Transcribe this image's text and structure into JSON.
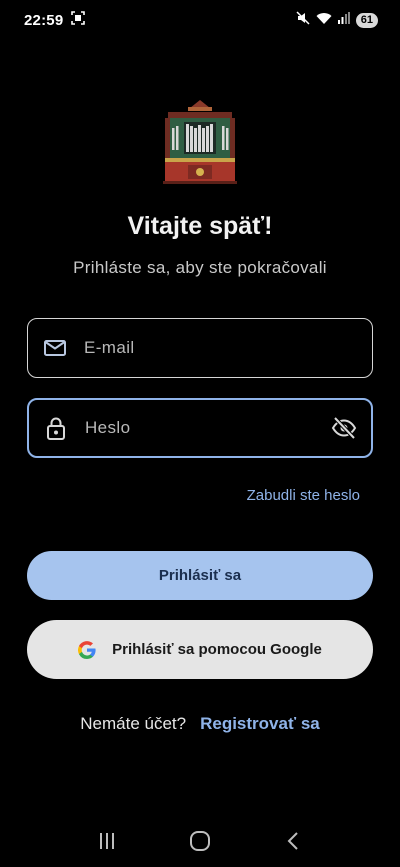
{
  "status_bar": {
    "time": "22:59",
    "battery": "61",
    "icons": [
      "screenshot-icon",
      "mute-icon",
      "wifi-icon",
      "signal-icon"
    ]
  },
  "header": {
    "title": "Vitajte späť!",
    "subtitle": "Prihláste sa, aby ste pokračovali",
    "logo_icon": "pipe-organ-icon"
  },
  "form": {
    "email": {
      "placeholder": "E-mail",
      "value": "",
      "icon": "mail-icon"
    },
    "password": {
      "placeholder": "Heslo",
      "value": "",
      "icon": "lock-icon",
      "toggle_icon": "visibility-off-icon"
    },
    "forgot_label": "Zabudli ste heslo",
    "login_label": "Prihlásiť sa",
    "google_label": "Prihlásiť sa pomocou Google"
  },
  "signup": {
    "prompt": "Nemáte účet?",
    "link": "Registrovať sa"
  },
  "colors": {
    "background": "#000000",
    "accent": "#8fb3e8",
    "primary_button": "#a6c4ee",
    "google_button": "#e5e5e5"
  },
  "nav": {
    "icons": [
      "recent-apps-icon",
      "home-icon",
      "back-icon"
    ]
  }
}
